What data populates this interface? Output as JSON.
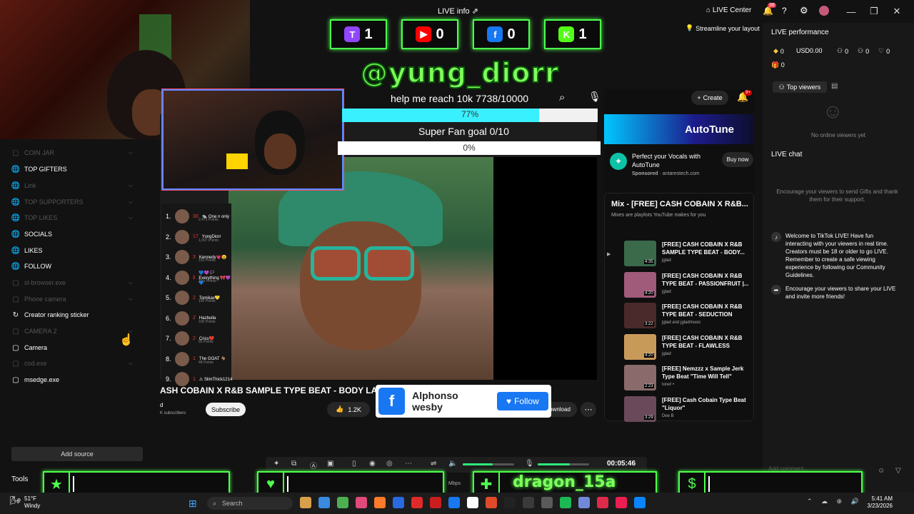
{
  "topbar": {
    "title": "LIVE info",
    "live_center": "LIVE Center",
    "notif_count": "38"
  },
  "overlay_counters": [
    {
      "platform": "twitch",
      "icon": "T",
      "color": "#9146ff",
      "count": "1"
    },
    {
      "platform": "youtube",
      "icon": "▶",
      "color": "#ff0000",
      "count": "0"
    },
    {
      "platform": "facebook",
      "icon": "f",
      "color": "#1877f2",
      "count": "0"
    },
    {
      "platform": "kick",
      "icon": "K",
      "color": "#53fc18",
      "count": "1"
    }
  ],
  "handle": "@yung_diorr",
  "goal": {
    "text": "help me reach 10k  7738/10000",
    "percent_label": "77%",
    "fraction": 0.77
  },
  "superfan": {
    "text": "Super Fan goal 0/10",
    "percent_label": "0%"
  },
  "sources": [
    {
      "label": "COIN JAR",
      "dim": true,
      "icon": "▢"
    },
    {
      "label": "TOP GIFTERS",
      "dim": false,
      "icon": "🌐"
    },
    {
      "label": "Link",
      "dim": true,
      "icon": "🌐"
    },
    {
      "label": "TOP SUPPORTERS",
      "dim": true,
      "icon": "🌐"
    },
    {
      "label": "TOP LIKES",
      "dim": true,
      "icon": "🌐"
    },
    {
      "label": "SOCIALS",
      "dim": false,
      "icon": "🌐"
    },
    {
      "label": "LIKES",
      "dim": false,
      "icon": "🌐"
    },
    {
      "label": "FOLLOW",
      "dim": false,
      "icon": "🌐"
    },
    {
      "label": "sl-browser.exe",
      "dim": true,
      "icon": "▢"
    },
    {
      "label": "Phone camera",
      "dim": true,
      "icon": "▢"
    },
    {
      "label": "Creator ranking sticker",
      "dim": false,
      "icon": "↻"
    },
    {
      "label": "CAMERA 2",
      "dim": true,
      "icon": "▢"
    },
    {
      "label": "Camera",
      "dim": false,
      "icon": "▢"
    },
    {
      "label": "cod.exe",
      "dim": true,
      "icon": "▢"
    },
    {
      "label": "msedge.exe",
      "dim": false,
      "icon": "▢"
    }
  ],
  "add_source": "Add source",
  "tools": "Tools",
  "leaderboard": [
    {
      "rank": "1.",
      "count": "30",
      "name": "🐀 One n only",
      "pts": "2,471 Points"
    },
    {
      "rank": "2.",
      "count": "17",
      "name": "YungDiorr",
      "pts": "1,097 Points"
    },
    {
      "rank": "3.",
      "count": "3",
      "name": "Kennedy💗😮",
      "pts": "315 Points"
    },
    {
      "rank": "4.",
      "count": "3",
      "name": "💙💜🏳 Everything 🎀💜💙",
      "pts": "10 k Points"
    },
    {
      "rank": "5.",
      "count": "2",
      "name": "Tomikax💛",
      "pts": "100 Points"
    },
    {
      "rank": "6.",
      "count": "2",
      "name": "Hazbulla",
      "pts": "100 Points"
    },
    {
      "rank": "7.",
      "count": "2",
      "name": "Criss💔",
      "pts": "55 Points"
    },
    {
      "rank": "8.",
      "count": "1",
      "name": "The GOAT 🐐",
      "pts": "48 Points"
    },
    {
      "rank": "9.",
      "count": "1",
      "name": "⚠ SlimThick1214",
      "pts": ""
    }
  ],
  "video": {
    "title": "ASH COBAIN X R&B SAMPLE TYPE BEAT - BODY LANG",
    "channel": "d",
    "subs": "K subscribers",
    "subscribe": "Subscribe",
    "likes": "1.2K",
    "download": "ownload"
  },
  "fbcard": {
    "name": "Alphonso wesby",
    "follow": "Follow"
  },
  "yt": {
    "create": "Create",
    "bell_badge": "9+",
    "ad": {
      "brand": "AutoTune",
      "title": "Perfect your Vocals with AutoTune",
      "sponsored": "Sponsored",
      "domain": "antarestech.com",
      "buy": "Buy now"
    },
    "mix_title": "Mix - [FREE] CASH COBAIN X R&B...",
    "mix_sub": "Mixes are playlists YouTube makes for you",
    "playlist": [
      {
        "title": "[FREE] CASH COBAIN X R&B SAMPLE TYPE BEAT - BODY...",
        "channel": "jglad",
        "dur": "4:35"
      },
      {
        "title": "[FREE] CASH COBAIN X R&B TYPE BEAT - PASSIONFRUIT |...",
        "channel": "jglad",
        "dur": "4:20"
      },
      {
        "title": "[FREE] CASH COBAIN X R&B TYPE BEAT - SEDUCTION",
        "channel": "jglad and jgladmusic",
        "dur": "3:22"
      },
      {
        "title": "[FREE] CASH COBAIN X R&B TYPE BEAT - FLAWLESS",
        "channel": "jglad",
        "dur": "4:20"
      },
      {
        "title": "[FREE] Nemzzz x Sample Jerk Type Beat \"Time Will Tell\"",
        "channel": "tone! •",
        "dur": "2:23"
      },
      {
        "title": "[FREE] Cash Cobain Type Beat \"Liquor\"",
        "channel": "Dee B",
        "dur": "3:29"
      }
    ]
  },
  "right_panel": {
    "streamline": "Streamline your layout",
    "perf_title": "LIVE performance",
    "stats": [
      {
        "icon": "◆",
        "value": "0"
      },
      {
        "icon": "",
        "value": "USD0.00"
      },
      {
        "icon": "⚇",
        "value": "0"
      },
      {
        "icon": "⚇",
        "value": "0"
      },
      {
        "icon": "♡",
        "value": "0"
      }
    ],
    "gifts": "0",
    "top_viewers": "Top viewers",
    "no_viewers": "No online viewers yet",
    "chat_title": "LIVE chat",
    "encourage": "Encourage your viewers to send Gifts and thank them for their support.",
    "welcome": "Welcome to TikTok LIVE! Have fun interacting with your viewers in real time. Creators must be 18 or older to go LIVE. Remember to create a safe viewing experience by following our Community Guidelines.",
    "share": "Encourage your viewers to share your LIVE and invite more friends!",
    "comment_placeholder": "Add comment..."
  },
  "controls": {
    "timer": "00:05:46",
    "bitrate": "Mbps",
    "mic_level": 0.62,
    "speaker_level": 0.58
  },
  "bottom_overlay": {
    "name": "dragon_15a"
  },
  "taskbar": {
    "temp": "51°F",
    "weather": "Windy",
    "search": "Search",
    "time": "5:41 AM",
    "date": "3/23/2026"
  },
  "colors": {
    "accent_green": "#4dff4d",
    "handle_green": "#7fff5a",
    "goal_fill": "#39f0ff",
    "facebook": "#1877f2"
  }
}
